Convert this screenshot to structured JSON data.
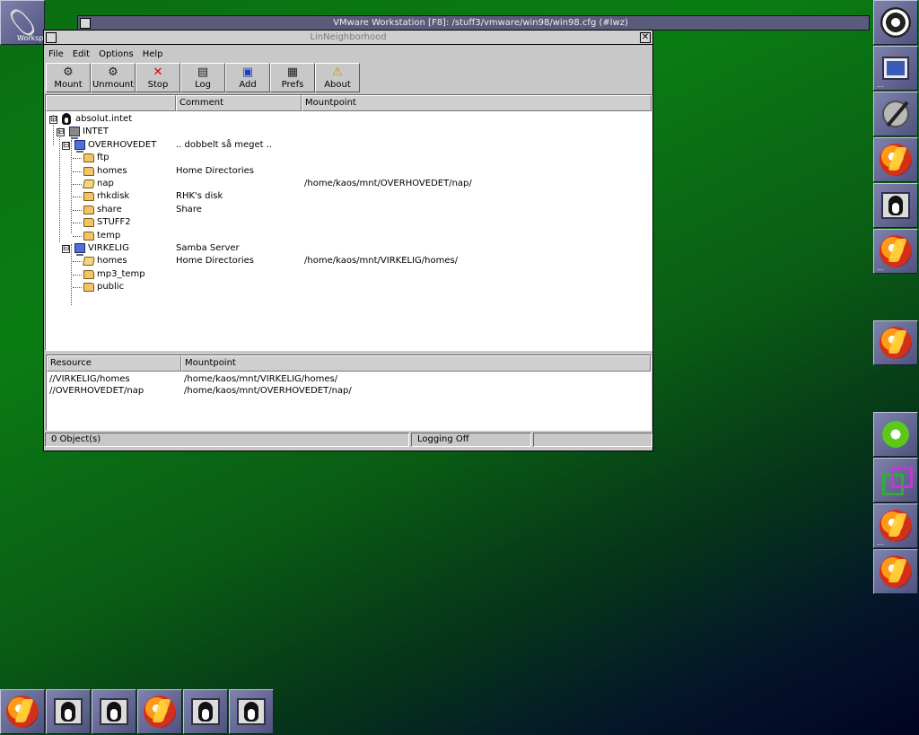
{
  "desktop": {
    "workspace_label": "Worksp",
    "vmware_title": "VMware Workstation [F8]: /stuff3/vmware/win98/win98.cfg (#lwz)",
    "dock_right": [
      {
        "name": "gnome-foot-tile",
        "icon": "gnome-foot-icon",
        "dots": false
      },
      {
        "name": "monitor-tile",
        "icon": "monitor-icon",
        "dots": true
      },
      {
        "name": "draw-tile",
        "icon": "pen-icon",
        "dots": false
      },
      {
        "name": "app-tile-1",
        "icon": "disc-icon",
        "dots": false
      },
      {
        "name": "tux-monitor-tile",
        "icon": "tux-monitor-icon",
        "dots": false
      },
      {
        "name": "app-tile-2",
        "icon": "disc-icon",
        "dots": true
      },
      {
        "name": "app-tile-3",
        "icon": "disc-icon",
        "dots": false
      },
      {
        "name": "icq-tile",
        "icon": "flower-icon",
        "dots": false
      },
      {
        "name": "pager-tile",
        "icon": "squares-icon",
        "dots": false
      },
      {
        "name": "app-tile-4",
        "icon": "disc-icon",
        "dots": true
      },
      {
        "name": "app-tile-5",
        "icon": "disc-icon",
        "dots": false
      }
    ],
    "dock_bottom": [
      {
        "name": "bottom-tile-1",
        "icon": "disc-icon"
      },
      {
        "name": "bottom-tile-2",
        "icon": "tux-monitor-icon"
      },
      {
        "name": "bottom-tile-3",
        "icon": "tux-monitor-icon"
      },
      {
        "name": "bottom-tile-4",
        "icon": "disc-icon"
      },
      {
        "name": "bottom-tile-5",
        "icon": "tux-monitor-icon"
      },
      {
        "name": "bottom-tile-6",
        "icon": "tux-monitor-icon"
      }
    ]
  },
  "window": {
    "title": "LinNeighborhood",
    "close_glyph": "✕",
    "menu": [
      "File",
      "Edit",
      "Options",
      "Help"
    ],
    "toolbar": [
      {
        "label": "Mount",
        "icon": "mount-icon",
        "glyph": "⚙",
        "color": "#222222"
      },
      {
        "label": "Unmount",
        "icon": "unmount-icon",
        "glyph": "⚙",
        "color": "#222222"
      },
      {
        "label": "Stop",
        "icon": "stop-icon",
        "glyph": "✕",
        "color": "#dd0000"
      },
      {
        "label": "Log",
        "icon": "log-icon",
        "glyph": "▤",
        "color": "#222222"
      },
      {
        "label": "Add",
        "icon": "add-icon",
        "glyph": "▣",
        "color": "#2040c0"
      },
      {
        "label": "Prefs",
        "icon": "prefs-icon",
        "glyph": "▦",
        "color": "#222222"
      },
      {
        "label": "About",
        "icon": "about-icon",
        "glyph": "⚠",
        "color": "#c89a00"
      }
    ],
    "tree_columns": [
      "",
      "Comment",
      "Mountpoint"
    ],
    "tree": [
      {
        "level": 0,
        "kind": "tux",
        "expander": "⊟",
        "name": "absolut.intet",
        "comment": "",
        "mountpoint": ""
      },
      {
        "level": 1,
        "kind": "workgroup",
        "expander": "⊟",
        "name": "INTET",
        "comment": "",
        "mountpoint": ""
      },
      {
        "level": 2,
        "kind": "computer",
        "expander": "⊟",
        "name": "OVERHOVEDET",
        "comment": ".. dobbelt så meget ..",
        "mountpoint": ""
      },
      {
        "level": 3,
        "kind": "folder",
        "name": "ftp",
        "comment": "",
        "mountpoint": ""
      },
      {
        "level": 3,
        "kind": "folder",
        "name": "homes",
        "comment": "Home Directories",
        "mountpoint": ""
      },
      {
        "level": 3,
        "kind": "folder-open",
        "name": "nap",
        "comment": "",
        "mountpoint": "/home/kaos/mnt/OVERHOVEDET/nap/"
      },
      {
        "level": 3,
        "kind": "folder",
        "name": "rhkdisk",
        "comment": "RHK's disk",
        "mountpoint": ""
      },
      {
        "level": 3,
        "kind": "folder",
        "name": "share",
        "comment": "Share",
        "mountpoint": ""
      },
      {
        "level": 3,
        "kind": "folder",
        "name": "STUFF2",
        "comment": "",
        "mountpoint": ""
      },
      {
        "level": 3,
        "kind": "folder",
        "name": "temp",
        "comment": "",
        "mountpoint": ""
      },
      {
        "level": 2,
        "kind": "computer",
        "expander": "⊟",
        "name": "VIRKELIG",
        "comment": "Samba Server",
        "mountpoint": ""
      },
      {
        "level": 3,
        "kind": "folder-open",
        "name": "homes",
        "comment": "Home Directories",
        "mountpoint": "/home/kaos/mnt/VIRKELIG/homes/"
      },
      {
        "level": 3,
        "kind": "folder",
        "name": "mp3_temp",
        "comment": "",
        "mountpoint": ""
      },
      {
        "level": 3,
        "kind": "folder",
        "name": "public",
        "comment": "",
        "mountpoint": ""
      }
    ],
    "mount_columns": [
      "Resource",
      "Mountpoint"
    ],
    "mounts": [
      {
        "resource": "//VIRKELIG/homes",
        "mountpoint": "/home/kaos/mnt/VIRKELIG/homes/"
      },
      {
        "resource": "//OVERHOVEDET/nap",
        "mountpoint": "/home/kaos/mnt/OVERHOVEDET/nap/"
      }
    ],
    "status": {
      "objects": "0 Object(s)",
      "logging": "Logging Off",
      "extra": ""
    }
  }
}
